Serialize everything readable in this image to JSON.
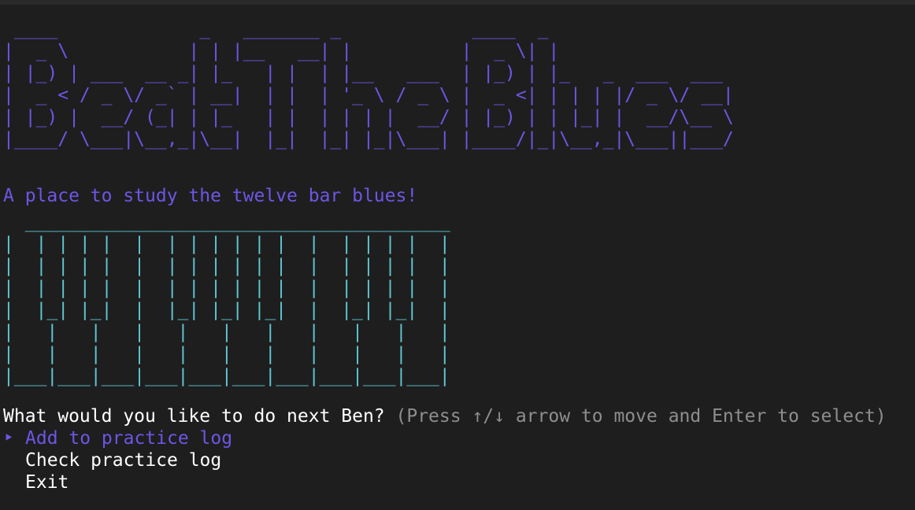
{
  "colors": {
    "background": "#1e1e1e",
    "logo": "#6f55e6",
    "tagline": "#6f55e6",
    "piano": "#5fc6d2",
    "prompt": "#ffffff",
    "hint": "#8e8e8e",
    "selected": "#6f55e6",
    "option": "#ffffff"
  },
  "logo_ascii": " ____             _   _______ _            ____  _\n|  _ \\           | | |__   __| |          |  _ \\| |\n| |_) | ___  __ _| |_   | |  | |__   ___  | |_) | |_   _  ___  ___\n|  _ < / _ \\/ _` | __|  | |  | '_ \\ / _ \\ |  _ <| | | | |/ _ \\/ __|\n| |_) |  __/ (_| | |_   | |  | | | |  __/ | |_) | | |_| |  __/\\__ \\\n|____/ \\___|\\__,_|\\__|  |_|  |_| |_|\\___| |____/|_|\\__,_|\\___||___/",
  "tagline": "A place to study the twelve bar blues!",
  "piano_ascii": "  _______________________________________\n|  | | | |  |  | | | | | |  |  | | | |  |\n|  | | | |  |  | | | | | |  |  | | | |  |\n|  | | | |  |  | | | | | |  |  | | | |  |\n|  |_| |_|  |  |_| |_| |_|  |  |_| |_|  |\n|   |   |   |   |   |   |   |   |   |   |\n|   |   |   |   |   |   |   |   |   |   |\n|___|___|___|___|___|___|___|___|___|___|",
  "prompt": {
    "question": "What would you like to do next Ben?",
    "hint": "(Press ↑/↓ arrow to move and Enter to select)"
  },
  "menu": {
    "pointer": "‣",
    "items": [
      {
        "label": "Add to practice log",
        "selected": true
      },
      {
        "label": "Check practice log",
        "selected": false
      },
      {
        "label": "Exit",
        "selected": false
      }
    ]
  }
}
